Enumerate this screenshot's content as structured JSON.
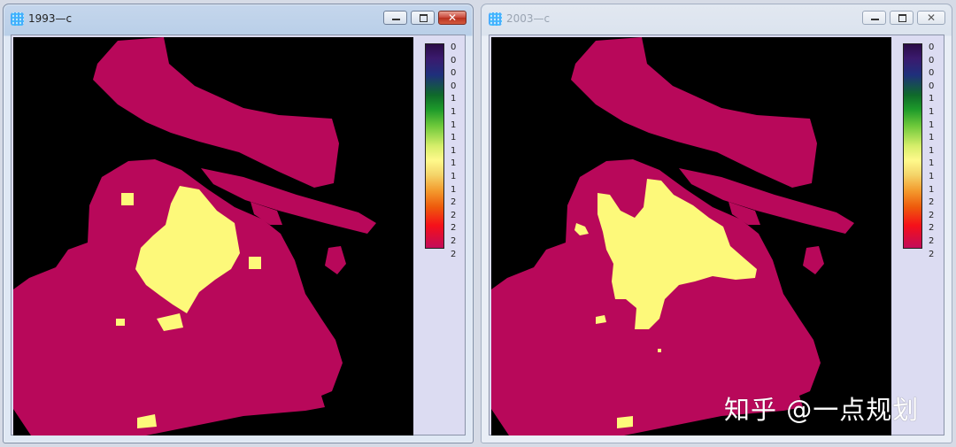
{
  "windows": [
    {
      "title": "1993—c",
      "state": "active",
      "legend_ticks": [
        "0",
        "0",
        "0",
        "0",
        "1",
        "1",
        "1",
        "1",
        "1",
        "1",
        "1",
        "1",
        "2",
        "2",
        "2",
        "2",
        "2"
      ]
    },
    {
      "title": "2003—c",
      "state": "inactive",
      "legend_ticks": [
        "0",
        "0",
        "0",
        "0",
        "1",
        "1",
        "1",
        "1",
        "1",
        "1",
        "1",
        "1",
        "2",
        "2",
        "2",
        "2",
        "2"
      ]
    }
  ],
  "controls": {
    "minimize_icon": "minimize-icon",
    "maximize_icon": "maximize-icon",
    "close_icon": "close-icon",
    "close_glyph": "✕"
  },
  "map_colors": {
    "background": "#000000",
    "land": "#b8085a",
    "urban": "#fdf97a"
  },
  "watermark": "知乎 @一点规划"
}
